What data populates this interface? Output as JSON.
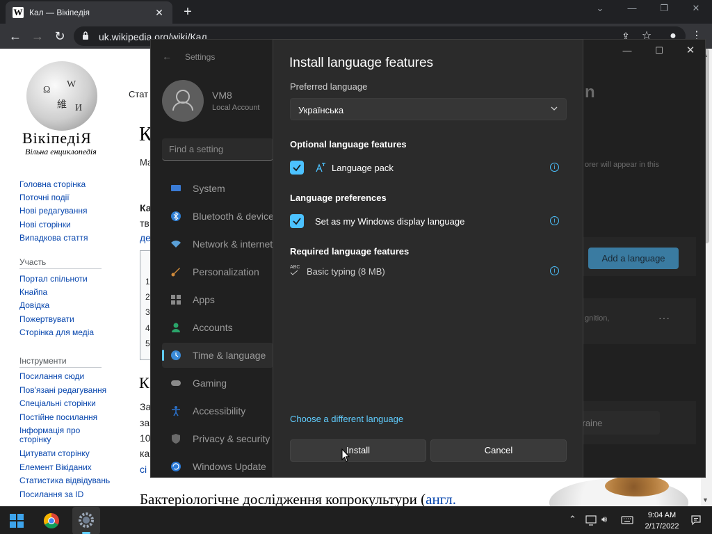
{
  "browser": {
    "tab_title": "Кал — Вікіпедія",
    "tab_favicon": "W",
    "url": "uk.wikipedia.org/wiki/Кал"
  },
  "wiki": {
    "site_name": "ВікіпедіЯ",
    "tagline": "Вільна енциклопедія",
    "nav_links": [
      "Головна сторінка",
      "Поточні події",
      "Нові редагування",
      "Нові сторінки",
      "Випадкова стаття"
    ],
    "section_participation": "Участь",
    "participation_links": [
      "Портал спільноти",
      "Кнайпа",
      "Довідка",
      "Пожертвувати",
      "Сторінка для медіа"
    ],
    "section_tools": "Інструменти",
    "tool_links": [
      "Посилання сюди",
      "Пов'язані редагування",
      "Спеціальні сторінки",
      "Постійне посилання",
      "Інформація про сторінку",
      "Цитувати сторінку",
      "Елемент Вікіданих",
      "Статистика відвідувань",
      "Посилання за ID"
    ],
    "article_tab_fragment": "Стат",
    "heading_fragment_1": "К",
    "heading_fragment_2": "К",
    "text_fragments": [
      "Ма",
      "Ка",
      "тв",
      "де",
      "За",
      "за",
      "10",
      "ка",
      "сі"
    ],
    "toc_numbers": [
      "1",
      "2",
      "3",
      "4",
      "5"
    ],
    "bottom_heading": "Бактеріологічне дослідження копрокультури (",
    "bottom_heading_link": "англ."
  },
  "settings": {
    "window_title": "Settings",
    "user_name": "VM8",
    "account_type": "Local Account",
    "search_placeholder": "Find a setting",
    "nav": [
      {
        "label": "System",
        "icon": "monitor-icon",
        "color": "#3a7bd5"
      },
      {
        "label": "Bluetooth & devices",
        "icon": "bluetooth-icon",
        "color": "#2d7dd2"
      },
      {
        "label": "Network & internet",
        "icon": "wifi-icon",
        "color": "#5aa0d8"
      },
      {
        "label": "Personalization",
        "icon": "brush-icon",
        "color": "#d08a3a"
      },
      {
        "label": "Apps",
        "icon": "apps-icon",
        "color": "#8a8a8a"
      },
      {
        "label": "Accounts",
        "icon": "person-icon",
        "color": "#2aa56a"
      },
      {
        "label": "Time & language",
        "icon": "globe-clock-icon",
        "color": "#3a8ad8"
      },
      {
        "label": "Gaming",
        "icon": "gamepad-icon",
        "color": "#8a8a8a"
      },
      {
        "label": "Accessibility",
        "icon": "accessibility-icon",
        "color": "#2a70c8"
      },
      {
        "label": "Privacy & security",
        "icon": "shield-icon",
        "color": "#6a6a6a"
      },
      {
        "label": "Windows Update",
        "icon": "update-icon",
        "color": "#2a7ad8"
      }
    ],
    "active_nav": "Time & language",
    "right_heading_fragment": "n",
    "right_text_1": "orer will appear in this",
    "add_language_label": "Add a language",
    "right_text_2": "gnition,",
    "more_dots": "···",
    "region_value": "kraine"
  },
  "dialog": {
    "title": "Install language features",
    "preferred_label": "Preferred language",
    "preferred_value": "Українська",
    "optional_heading": "Optional language features",
    "language_pack_label": "Language pack",
    "language_pack_checked": true,
    "preferences_heading": "Language preferences",
    "display_language_label": "Set as my Windows display language",
    "display_language_checked": true,
    "required_heading": "Required language features",
    "basic_typing_label": "Basic typing (8 MB)",
    "abc_glyph": "ABC",
    "choose_link": "Choose a different language",
    "install_label": "Install",
    "cancel_label": "Cancel",
    "accent": "#4cc2ff"
  },
  "taskbar": {
    "apps": [
      "windows-start-icon",
      "chrome-icon",
      "settings-icon"
    ],
    "time": "9:04 AM",
    "date": "2/17/2022"
  }
}
